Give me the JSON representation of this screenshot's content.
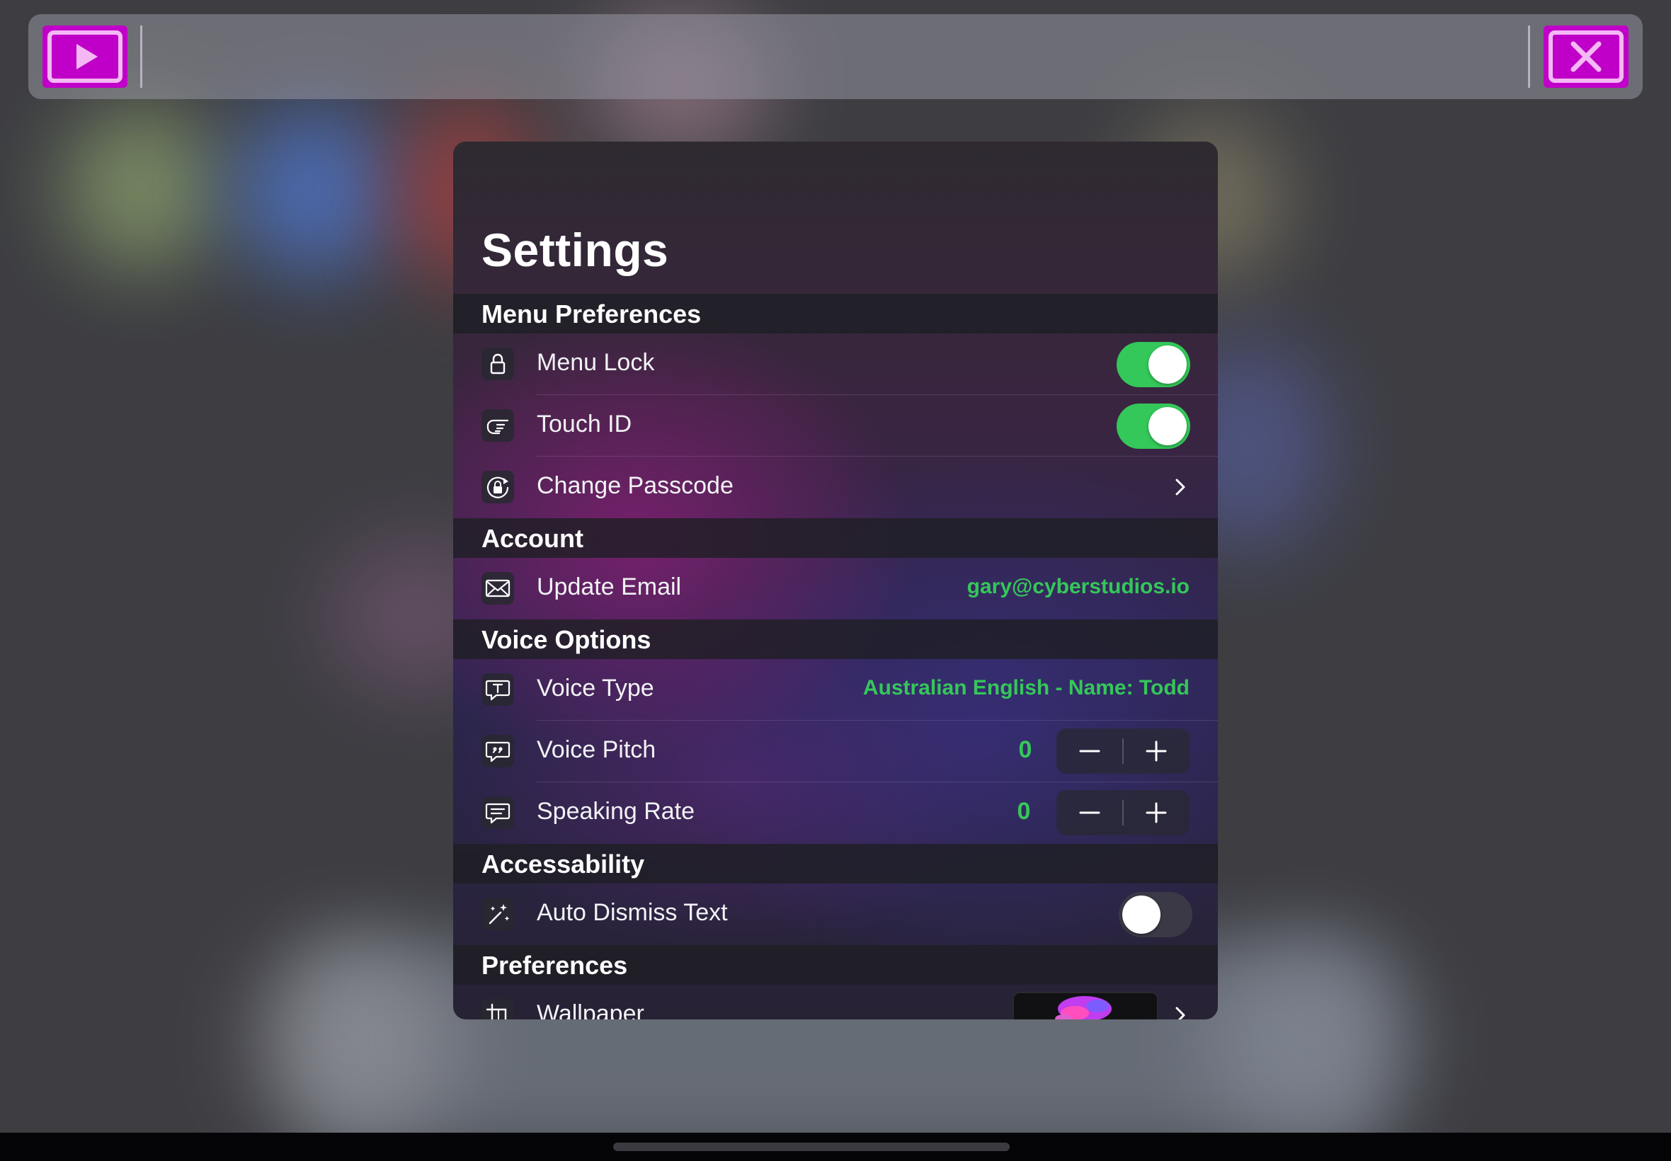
{
  "toolbar": {
    "play_icon": "play-icon",
    "close_icon": "close-icon",
    "accent": "#c000c8"
  },
  "settings": {
    "title": "Settings",
    "sections": {
      "menu_preferences": "Menu Preferences",
      "account": "Account",
      "voice_options": "Voice Options",
      "accessability": "Accessability",
      "preferences": "Preferences"
    },
    "rows": {
      "menu_lock": {
        "label": "Menu Lock",
        "icon": "lock-icon",
        "toggle": true
      },
      "touch_id": {
        "label": "Touch ID",
        "icon": "touch-hand-icon",
        "toggle": true
      },
      "change_passcode": {
        "label": "Change Passcode",
        "icon": "lock-rotate-icon"
      },
      "update_email": {
        "label": "Update Email",
        "icon": "envelope-icon",
        "value": "gary@cyberstudios.io"
      },
      "voice_type": {
        "label": "Voice Type",
        "icon": "text-bubble-icon",
        "value": "Australian English - Name: Todd"
      },
      "voice_pitch": {
        "label": "Voice Pitch",
        "icon": "quote-bubble-icon",
        "value": "0"
      },
      "speaking_rate": {
        "label": "Speaking Rate",
        "icon": "text-lines-bubble-icon",
        "value": "0"
      },
      "auto_dismiss_text": {
        "label": "Auto Dismiss Text",
        "icon": "magic-wand-icon",
        "toggle": false
      },
      "wallpaper": {
        "label": "Wallpaper",
        "icon": "crop-icon"
      }
    },
    "colors": {
      "accent_green": "#35c759",
      "toggle_on": "#34c759"
    }
  }
}
